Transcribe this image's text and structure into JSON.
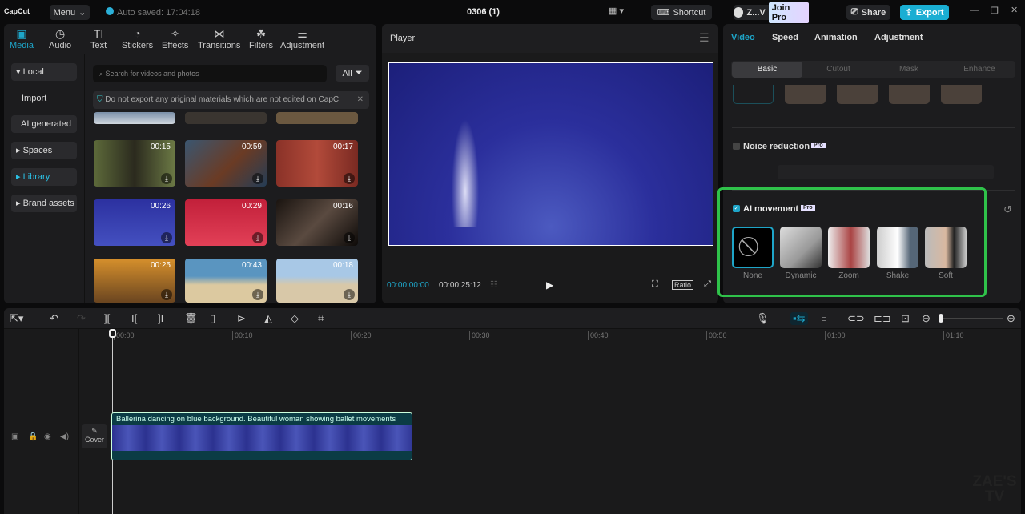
{
  "topbar": {
    "logo": "CapCut",
    "menu": "Menu",
    "autosave": "Auto saved: 17:04:18",
    "title": "0306 (1)",
    "shortcut": "Shortcut",
    "user": "Z...V",
    "join_pro": "Join Pro",
    "share": "Share",
    "export": "Export"
  },
  "media_tabs": [
    {
      "label": "Media",
      "icon": "▣"
    },
    {
      "label": "Audio",
      "icon": "◷"
    },
    {
      "label": "Text",
      "icon": "TI"
    },
    {
      "label": "Stickers",
      "icon": "◔"
    },
    {
      "label": "Effects",
      "icon": "✧"
    },
    {
      "label": "Transitions",
      "icon": "⋈"
    },
    {
      "label": "Filters",
      "icon": "☘"
    },
    {
      "label": "Adjustment",
      "icon": "⚌"
    }
  ],
  "sidebar": [
    "▾ Local",
    "Import",
    "AI generated",
    "▸ Spaces",
    "▸ Library",
    "▸ Brand assets"
  ],
  "search": {
    "placeholder": "Search for videos and photos",
    "filter": "All"
  },
  "notice": "Do not export any original materials which are not edited on CapC",
  "thumbs": [
    {
      "dur": "00:15"
    },
    {
      "dur": "00:59"
    },
    {
      "dur": "00:17"
    },
    {
      "dur": "00:26"
    },
    {
      "dur": "00:29"
    },
    {
      "dur": "00:16"
    },
    {
      "dur": "00:25"
    },
    {
      "dur": "00:43"
    },
    {
      "dur": "00:18"
    }
  ],
  "player": {
    "title": "Player",
    "current": "00:00:00:00",
    "total": "00:00:25:12",
    "ratio": "Ratio"
  },
  "right": {
    "tabs": [
      "Video",
      "Speed",
      "Animation",
      "Adjustment"
    ],
    "subtabs": [
      "Basic",
      "Cutout",
      "Mask",
      "Enhance"
    ],
    "noise": "Noice reduction",
    "pro": "Pro",
    "ai_movement": "AI movement",
    "movements": [
      "None",
      "Dynamic",
      "Zoom",
      "Shake",
      "Soft"
    ]
  },
  "timeline": {
    "ticks": [
      "00:00",
      "00:10",
      "00:20",
      "00:30",
      "00:40",
      "00:50",
      "01:00",
      "01:10"
    ],
    "clip_title": "Ballerina dancing on blue background. Beautiful woman showing ballet movements",
    "cover": "Cover"
  },
  "watermark": "ZAE'S TV"
}
